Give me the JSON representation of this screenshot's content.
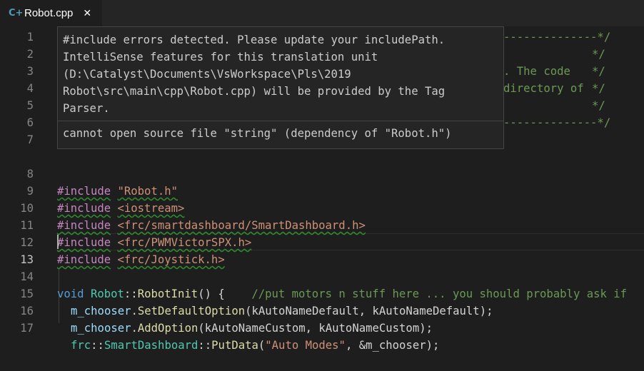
{
  "tab": {
    "label": "Robot.cpp",
    "close_glyph": "✕",
    "icon": "cpp-file-icon",
    "icon_glyph": "C+"
  },
  "hover": {
    "message_lines": [
      "#include errors detected. Please update your includePath.",
      "IntelliSense features for this translation unit",
      "(D:\\Catalyst\\Documents\\VsWorkspace\\Pls\\2019",
      "Robot\\src\\main\\cpp\\Robot.cpp) will be provided by the Tag",
      "Parser."
    ],
    "error": "cannot open source file \"string\" (dependency of \"Robot.h\")"
  },
  "hidden_fragments": {
    "l1": "--------------*/",
    "l2": "*/",
    "l3a": ". The code",
    "l3b": "*/",
    "l4a": "directory of",
    "l4b": "*/",
    "l5": "*/",
    "l6": "--------------*/"
  },
  "lines": {
    "l8": {
      "num": "8",
      "kw": "#include",
      "arg": "\"Robot.h\""
    },
    "l9": {
      "num": "9",
      "kw": "#include",
      "arg": "<iostream>"
    },
    "l10": {
      "num": "10",
      "kw": "#include",
      "arg": "<frc/smartdashboard/SmartDashboard.h>"
    },
    "l11": {
      "num": "11",
      "kw": "#include",
      "arg": "<frc/PWMVictorSPX.h>"
    },
    "l12": {
      "num": "12",
      "kw": "#include",
      "arg": "<frc/Joystick.h>"
    },
    "l13": {
      "num": "13"
    },
    "l14": {
      "num": "14",
      "void": "void",
      "cls": "Robot",
      "sep": "::",
      "fn": "RobotInit",
      "rest": "() {",
      "comment": "//put motors n stuff here ... you should probably ask if"
    },
    "l15": {
      "num": "15",
      "obj": "m_chooser",
      "dot": ".",
      "fn": "SetDefaultOption",
      "args": "(kAutoNameDefault, kAutoNameDefault);"
    },
    "l16": {
      "num": "16",
      "obj": "m_chooser",
      "dot": ".",
      "fn": "AddOption",
      "args": "(kAutoNameCustom, kAutoNameCustom);"
    },
    "l17": {
      "num": "17",
      "ns1": "frc",
      "sep1": "::",
      "ns2": "SmartDashboard",
      "sep2": "::",
      "fn": "PutData",
      "open": "(",
      "str": "\"Auto Modes\"",
      "rest": ", &m_chooser);"
    }
  },
  "line_numbers_top": [
    "1",
    "2",
    "3",
    "4",
    "5",
    "6",
    "7"
  ]
}
